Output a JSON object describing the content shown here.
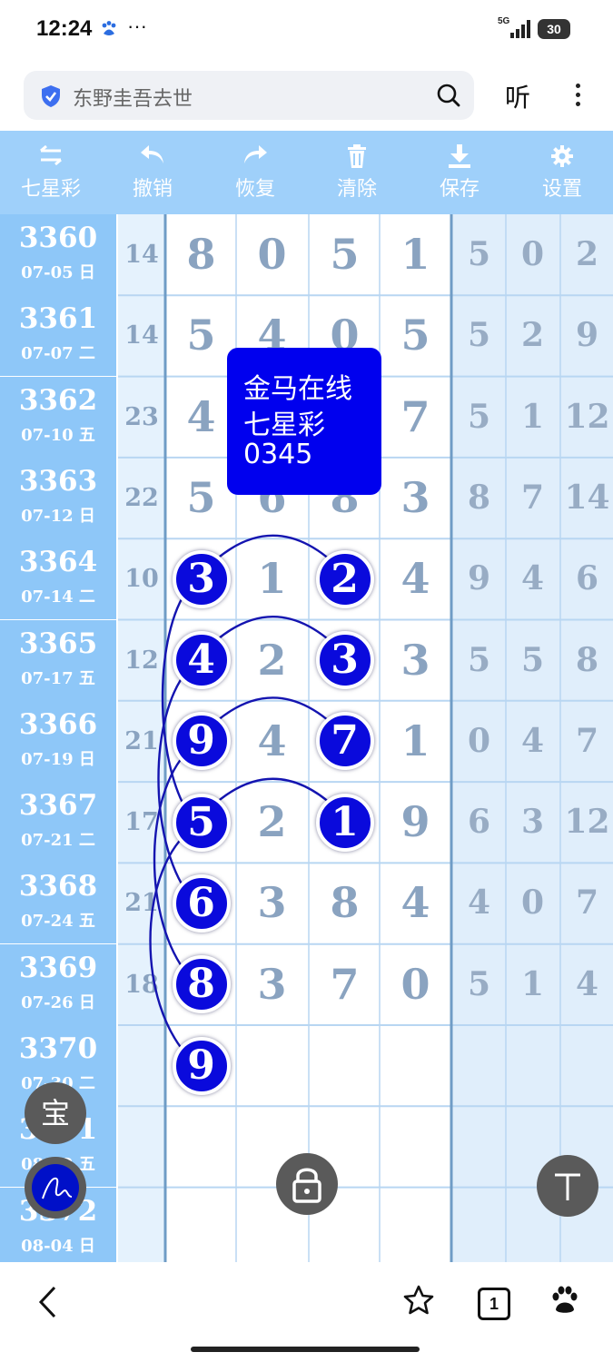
{
  "status": {
    "time": "12:24",
    "dots": "···",
    "network": "5G",
    "battery": "30"
  },
  "search": {
    "text": "东野圭吾去世",
    "listen_label": "听"
  },
  "toolbar": [
    {
      "label": "七星彩",
      "icon": "swap-icon"
    },
    {
      "label": "撤销",
      "icon": "undo-icon"
    },
    {
      "label": "恢复",
      "icon": "redo-icon"
    },
    {
      "label": "清除",
      "icon": "trash-icon"
    },
    {
      "label": "保存",
      "icon": "download-icon"
    },
    {
      "label": "设置",
      "icon": "gear-icon"
    }
  ],
  "rows": [
    {
      "issue": "3360",
      "date": "07-05 日",
      "sum": "14",
      "digits": [
        "8",
        "0",
        "5",
        "1"
      ],
      "right": [
        "5",
        "0",
        "2"
      ]
    },
    {
      "issue": "3361",
      "date": "07-07 二",
      "sum": "14",
      "digits": [
        "5",
        "4",
        "0",
        "5"
      ],
      "right": [
        "5",
        "2",
        "9"
      ]
    },
    {
      "issue": "3362",
      "date": "07-10 五",
      "sum": "23",
      "digits": [
        "4",
        "",
        "",
        "7"
      ],
      "right": [
        "5",
        "1",
        "12"
      ]
    },
    {
      "issue": "3363",
      "date": "07-12 日",
      "sum": "22",
      "digits": [
        "5",
        "6",
        "8",
        "3"
      ],
      "right": [
        "8",
        "7",
        "14"
      ]
    },
    {
      "issue": "3364",
      "date": "07-14 二",
      "sum": "10",
      "digits": [
        "3",
        "1",
        "2",
        "4"
      ],
      "right": [
        "9",
        "4",
        "6"
      ]
    },
    {
      "issue": "3365",
      "date": "07-17 五",
      "sum": "12",
      "digits": [
        "4",
        "2",
        "3",
        "3"
      ],
      "right": [
        "5",
        "5",
        "8"
      ]
    },
    {
      "issue": "3366",
      "date": "07-19 日",
      "sum": "21",
      "digits": [
        "9",
        "4",
        "7",
        "1"
      ],
      "right": [
        "0",
        "4",
        "7"
      ]
    },
    {
      "issue": "3367",
      "date": "07-21 二",
      "sum": "17",
      "digits": [
        "5",
        "2",
        "1",
        "9"
      ],
      "right": [
        "6",
        "3",
        "12"
      ]
    },
    {
      "issue": "3368",
      "date": "07-24 五",
      "sum": "21",
      "digits": [
        "6",
        "3",
        "8",
        "4"
      ],
      "right": [
        "4",
        "0",
        "7"
      ]
    },
    {
      "issue": "3369",
      "date": "07-26 日",
      "sum": "18",
      "digits": [
        "8",
        "3",
        "7",
        "0"
      ],
      "right": [
        "5",
        "1",
        "4"
      ]
    },
    {
      "issue": "3370",
      "date": "07-30 二",
      "sum": "",
      "digits": [
        "9",
        "",
        "",
        ""
      ],
      "right": [
        "",
        "",
        ""
      ]
    },
    {
      "issue": "3371",
      "date": "08-02 五",
      "sum": "",
      "digits": [
        "",
        "",
        "",
        ""
      ],
      "right": [
        "",
        "",
        ""
      ]
    },
    {
      "issue": "3372",
      "date": "08-04 日",
      "sum": "",
      "digits": [
        "",
        "",
        "",
        ""
      ],
      "right": [
        "",
        "",
        ""
      ]
    }
  ],
  "highlights": [
    {
      "row": 4,
      "col": 0,
      "value": "3"
    },
    {
      "row": 4,
      "col": 2,
      "value": "2"
    },
    {
      "row": 5,
      "col": 0,
      "value": "4"
    },
    {
      "row": 5,
      "col": 2,
      "value": "3"
    },
    {
      "row": 6,
      "col": 0,
      "value": "9"
    },
    {
      "row": 6,
      "col": 2,
      "value": "7"
    },
    {
      "row": 7,
      "col": 0,
      "value": "5"
    },
    {
      "row": 7,
      "col": 2,
      "value": "1"
    },
    {
      "row": 8,
      "col": 0,
      "value": "6"
    },
    {
      "row": 9,
      "col": 0,
      "value": "8"
    },
    {
      "row": 10,
      "col": 0,
      "value": "9"
    }
  ],
  "note": {
    "line1": "金马在线",
    "line2": "七星彩",
    "line3": "0345"
  },
  "fabs": {
    "bao": "宝"
  },
  "bottom": {
    "tab_count": "1"
  },
  "colors": {
    "toolbar": "#9fd0fa",
    "label_col": "#8ec7f8",
    "highlight": "#0a0adc",
    "note_bg": "#0000ee",
    "digit": "#8aa3c0"
  }
}
